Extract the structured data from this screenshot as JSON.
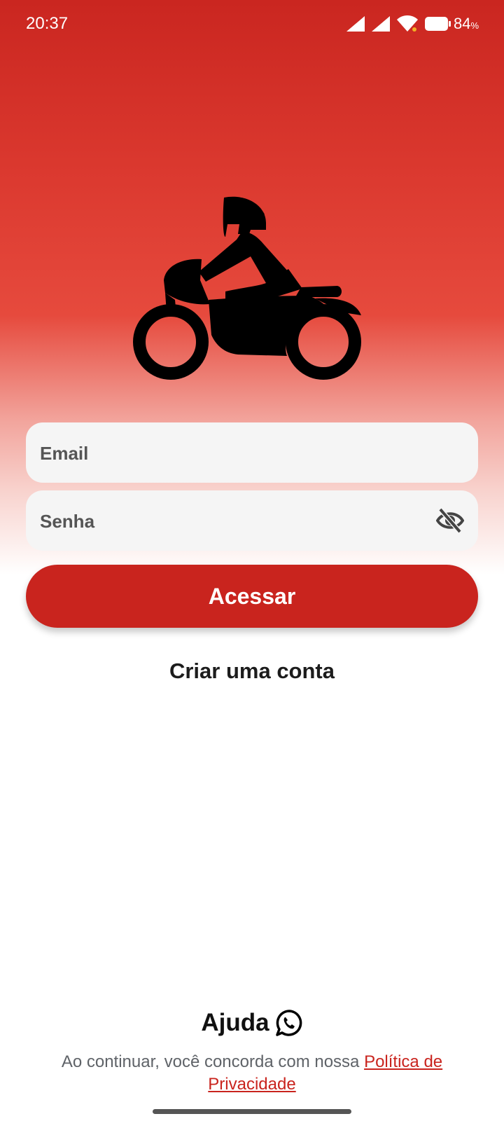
{
  "status_bar": {
    "time": "20:37",
    "battery_level": "84",
    "battery_unit": "%"
  },
  "form": {
    "email_placeholder": "Email",
    "password_placeholder": "Senha",
    "submit_label": "Acessar",
    "create_account_label": "Criar uma conta"
  },
  "footer": {
    "help_label": "Ajuda",
    "terms_text": "Ao continuar, você concorda com nossa ",
    "privacy_link_text": "Política de Privacidade"
  },
  "colors": {
    "brand": "#c9241e",
    "field_bg": "#f5f5f5",
    "link": "#c9241e"
  },
  "icons": {
    "logo": "motorcycle-rider-icon",
    "password_toggle": "eye-off-icon",
    "help": "whatsapp-icon"
  }
}
